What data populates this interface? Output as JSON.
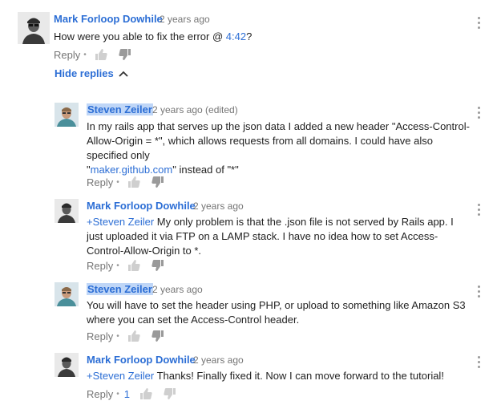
{
  "top_comment": {
    "author": "Mark Forloop Dowhile",
    "time": "2 years ago",
    "text_before": "How were you able to fix the error @ ",
    "timestamp_link": "4:42",
    "text_after": "?",
    "reply_label": "Reply",
    "hide_replies_label": "Hide replies"
  },
  "replies": [
    {
      "author": "Steven Zeiler",
      "time": "2 years ago (edited)",
      "text_main": "In my rails app that serves up the json data I added a new header \"Access-Control-Allow-Origin = *\", which allows requests from all domains. I could have also specified only",
      "text_q1": "\"",
      "link": "maker.github.com",
      "text_tail": "\" instead of \"*\"",
      "reply_label": "Reply"
    },
    {
      "author": "Mark Forloop Dowhile",
      "time": "2 years ago",
      "mention": "+Steven Zeiler",
      "text": " My only problem is that the .json file is not served by Rails app. I just uploaded it via FTP on a LAMP stack. I have no idea how to set Access-Control-Allow-Origin to *.",
      "reply_label": "Reply"
    },
    {
      "author": "Steven Zeiler",
      "time": "2 years ago",
      "text": "You will have to set the header using PHP, or upload to something like Amazon S3 where you can set the Access-Control header.",
      "reply_label": "Reply"
    },
    {
      "author": "Mark Forloop Dowhile",
      "time": "2 years ago",
      "mention": "+Steven Zeiler",
      "text": " Thanks! Finally fixed it. Now I can move forward to the tutorial!",
      "reply_label": "Reply",
      "like_count": "1"
    }
  ],
  "icons": {
    "like": "thumbs-up-icon",
    "dislike": "thumbs-down-icon",
    "menu": "more-vert-icon",
    "chevron": "chevron-up-icon"
  },
  "colors": {
    "link": "#2c6ed5",
    "highlight": "#bfd6f7",
    "meta": "#767676"
  }
}
